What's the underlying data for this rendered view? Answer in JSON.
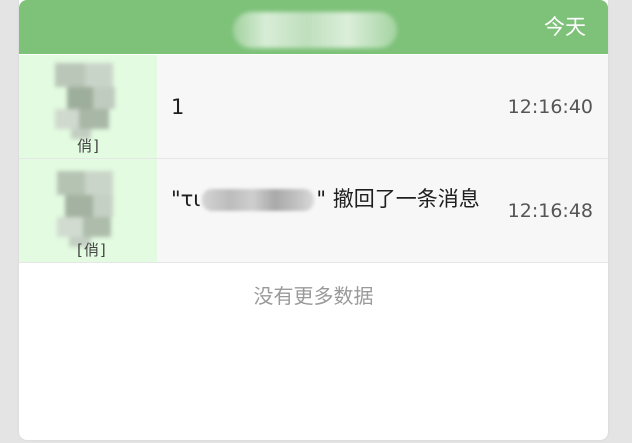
{
  "header": {
    "title_redacted": true,
    "date_label": "今天"
  },
  "messages": [
    {
      "avatar_name_fragment": "俏]",
      "text": "1",
      "time": "12:16:40"
    },
    {
      "avatar_name_fragment": "[俏]",
      "text_prefix": "\"τι",
      "text_suffix": "\" 撤回了一条消息",
      "time": "12:16:48"
    }
  ],
  "footer": {
    "no_more_text": "没有更多数据"
  },
  "colors": {
    "header_green": "#7ec27a",
    "avatar_bg": "#e3fbe1",
    "row_bg": "#f6f7f6",
    "muted_text": "#9a9a9a"
  }
}
